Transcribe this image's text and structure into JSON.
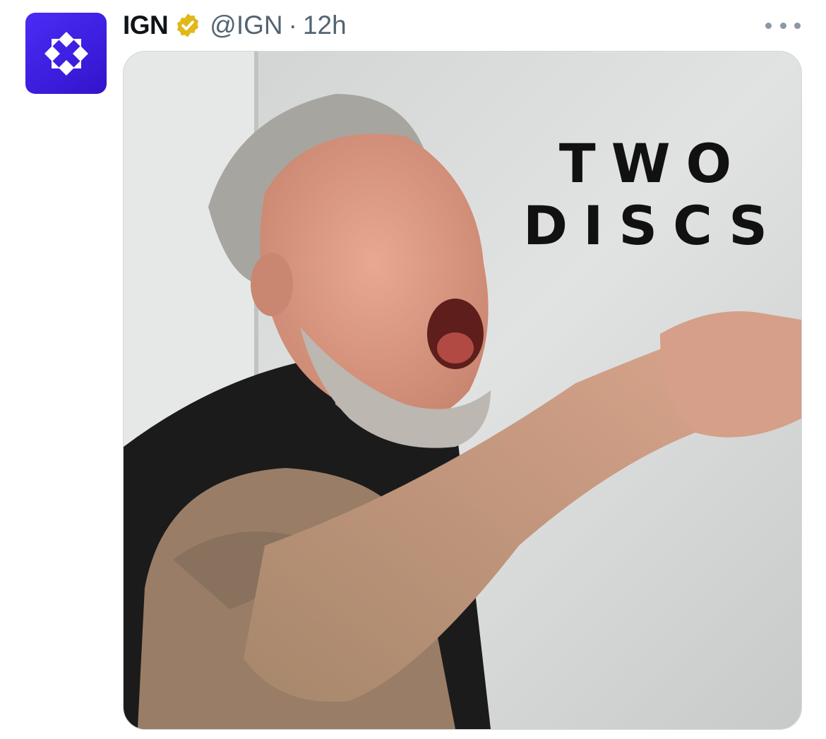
{
  "tweet": {
    "display_name": "IGN",
    "handle": "@IGN",
    "separator": "·",
    "time": "12h",
    "verified": true,
    "verified_color": "#e2b719",
    "avatar_color": "#3e21e8",
    "avatar_icon": "ign-logo-icon",
    "more_icon": "more-dots-icon"
  },
  "media": {
    "caption_lines": [
      "TWO",
      "DISCS"
    ]
  }
}
